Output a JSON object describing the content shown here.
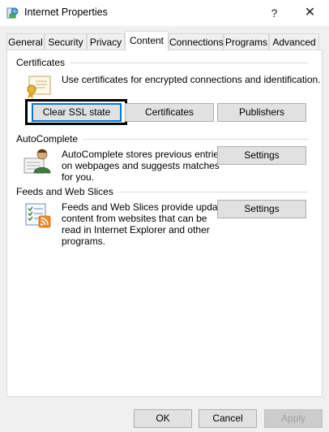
{
  "window": {
    "title": "Internet Properties",
    "help_glyph": "?",
    "close_glyph": "✕"
  },
  "tabs": [
    {
      "label": "General"
    },
    {
      "label": "Security"
    },
    {
      "label": "Privacy"
    },
    {
      "label": "Content",
      "active": true
    },
    {
      "label": "Connections"
    },
    {
      "label": "Programs"
    },
    {
      "label": "Advanced"
    }
  ],
  "certificates": {
    "group_label": "Certificates",
    "description": "Use certificates for encrypted connections and identification.",
    "clear_ssl_label": "Clear SSL state",
    "certificates_label": "Certificates",
    "publishers_label": "Publishers"
  },
  "autocomplete": {
    "group_label": "AutoComplete",
    "description_lines": [
      "AutoComplete stores previous entries",
      "on webpages and suggests matches",
      "for you."
    ],
    "settings_label": "Settings"
  },
  "feeds": {
    "group_label": "Feeds and Web Slices",
    "description_lines": [
      "Feeds and Web Slices provide updated",
      "content from websites that can be",
      "read in Internet Explorer and other",
      "programs."
    ],
    "settings_label": "Settings"
  },
  "footer": {
    "ok_label": "OK",
    "cancel_label": "Cancel",
    "apply_label": "Apply"
  },
  "colors": {
    "focus_blue": "#0078d7",
    "button_face": "#e1e1e1",
    "panel": "#ffffff",
    "dialog": "#f0f0f0"
  }
}
